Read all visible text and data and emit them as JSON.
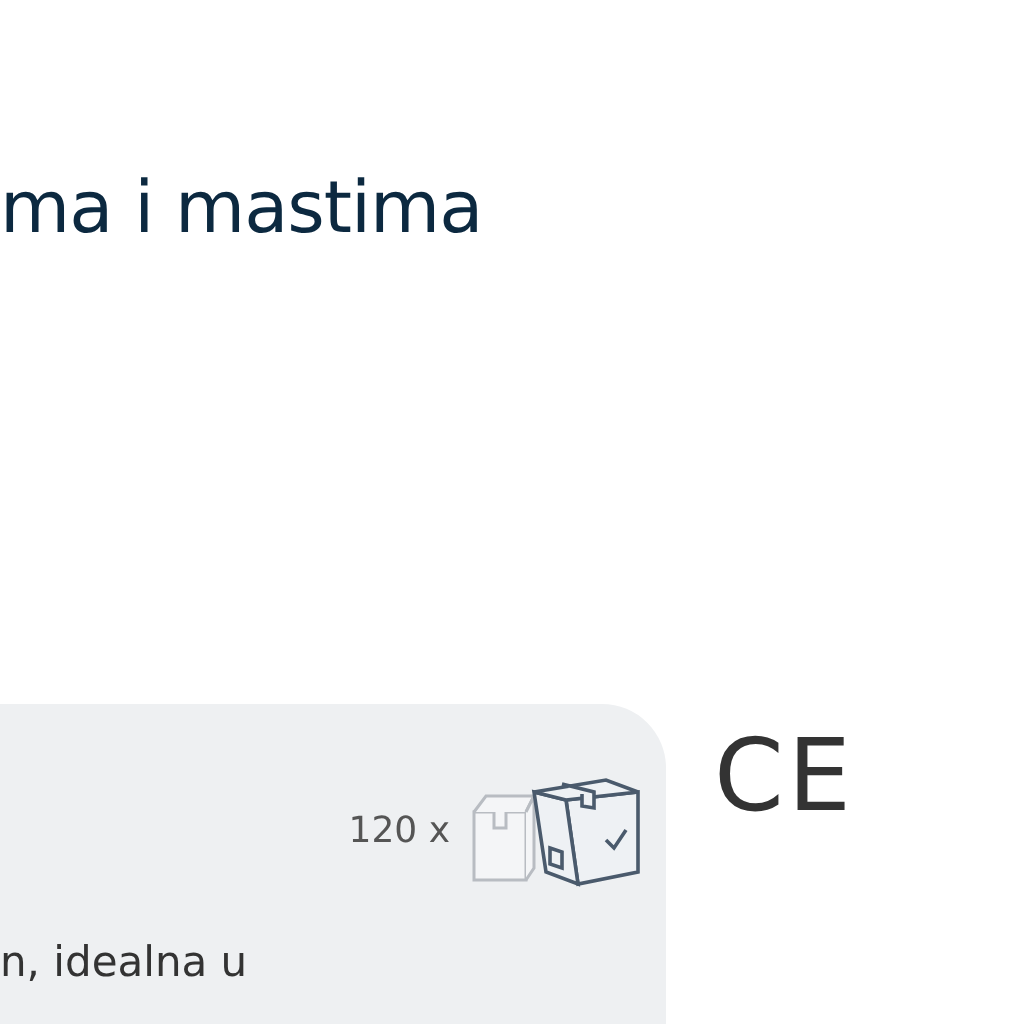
{
  "heading": "ma i mastima",
  "card": {
    "quantity": "120 x",
    "description": "n, idealna u"
  },
  "certification_mark": "CE"
}
